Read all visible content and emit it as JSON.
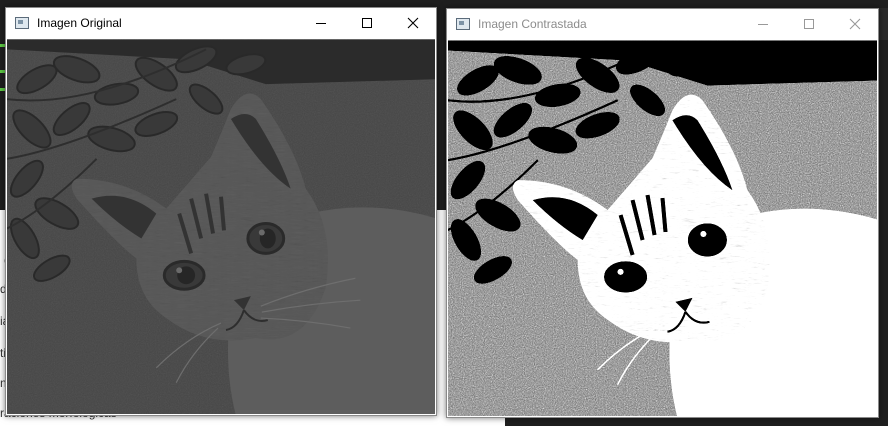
{
  "background": {
    "doc_lines": [
      "C",
      "d",
      "ia",
      "ti",
      "n",
      "raciones morfológicas"
    ]
  },
  "windows": [
    {
      "title": "Imagen Original",
      "controls": [
        "minimize",
        "maximize",
        "close"
      ]
    },
    {
      "title": "Imagen Contrastada",
      "controls": [
        "minimize",
        "maximize",
        "close"
      ]
    }
  ]
}
